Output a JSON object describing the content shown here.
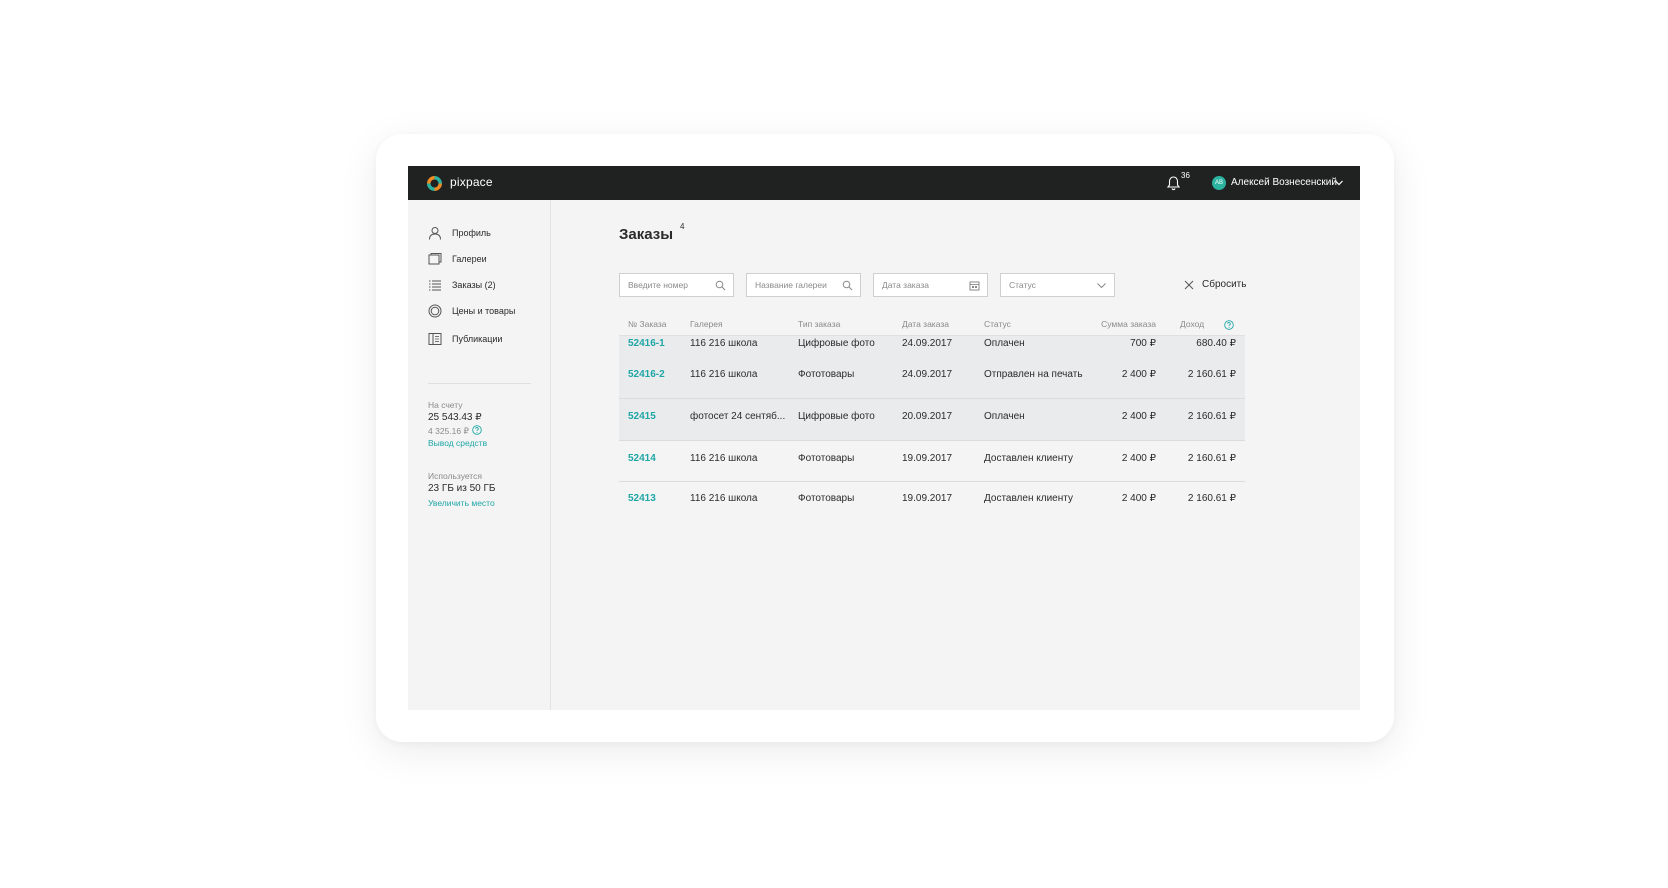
{
  "topbar": {
    "logo_text": "pixpace",
    "notification_count": "36",
    "avatar_initials": "АВ",
    "user_name": "Алексей Вознесенский"
  },
  "sidebar": {
    "items": [
      {
        "label": "Профиль",
        "icon": "user-icon"
      },
      {
        "label": "Галереи",
        "icon": "gallery-icon"
      },
      {
        "label": "Заказы (2)",
        "icon": "list-icon"
      },
      {
        "label": "Цены и товары",
        "icon": "circle-icon"
      },
      {
        "label": "Публикации",
        "icon": "book-icon"
      }
    ],
    "balance": {
      "label": "На счету",
      "value": "25 543.43 ₽",
      "pending": "4 325.16 ₽",
      "link": "Вывод средств"
    },
    "storage": {
      "label": "Используется",
      "value": "23 ГБ из 50 ГБ",
      "link": "Увеличить место"
    }
  },
  "main": {
    "title": "Заказы",
    "title_count": "4",
    "filters": {
      "number_placeholder": "Введите номер",
      "gallery_placeholder": "Название галереи",
      "date_placeholder": "Дата заказа",
      "status_placeholder": "Статус",
      "reset_label": "Сбросить"
    },
    "table": {
      "headers": [
        "№ Заказа",
        "Галерея",
        "Тип заказа",
        "Дата заказа",
        "Статус",
        "Сумма заказа",
        "Доход"
      ],
      "rows": [
        {
          "num": "52416-1",
          "gallery": "116 216 школа",
          "type": "Цифровые фото",
          "date": "24.09.2017",
          "status": "Оплачен",
          "sum": "700 ₽",
          "income": "680.40 ₽"
        },
        {
          "num": "52416-2",
          "gallery": "116 216 школа",
          "type": "Фототовары",
          "date": "24.09.2017",
          "status": "Отправлен на печать",
          "sum": "2 400 ₽",
          "income": "2 160.61 ₽"
        },
        {
          "num": "52415",
          "gallery": "фотосет 24 сентяб...",
          "type": "Цифровые фото",
          "date": "20.09.2017",
          "status": "Оплачен",
          "sum": "2 400 ₽",
          "income": "2 160.61 ₽"
        },
        {
          "num": "52414",
          "gallery": "116 216 школа",
          "type": "Фототовары",
          "date": "19.09.2017",
          "status": "Доставлен клиенту",
          "sum": "2 400 ₽",
          "income": "2 160.61 ₽"
        },
        {
          "num": "52413",
          "gallery": "116 216 школа",
          "type": "Фототовары",
          "date": "19.09.2017",
          "status": "Доставлен клиенту",
          "sum": "2 400 ₽",
          "income": "2 160.61 ₽"
        }
      ]
    }
  },
  "colors": {
    "accent": "#1fa6a6",
    "topbar": "#1f2221",
    "logo_orange": "#f08a24",
    "logo_teal": "#2bb3a0"
  }
}
